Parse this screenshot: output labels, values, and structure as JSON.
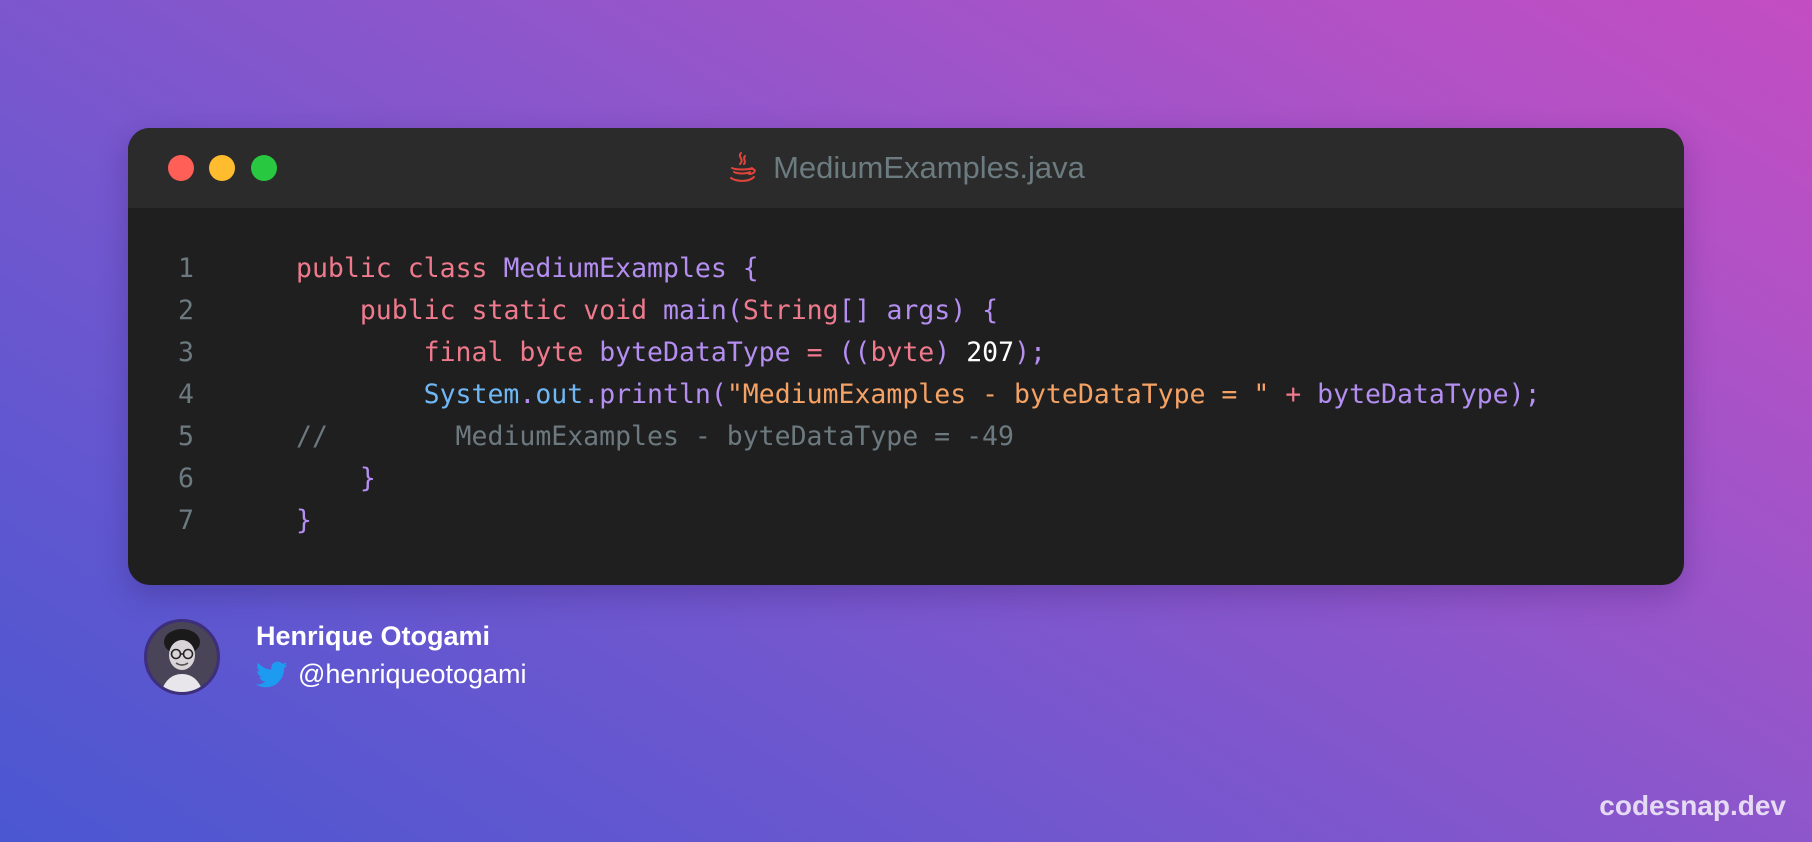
{
  "window": {
    "filename": "MediumExamples.java",
    "language_icon": "java-icon",
    "controls": [
      "close",
      "minimize",
      "maximize"
    ]
  },
  "code": {
    "lines": [
      {
        "number": "1",
        "tokens": [
          {
            "t": "public",
            "c": "kw"
          },
          {
            "t": " ",
            "c": ""
          },
          {
            "t": "class",
            "c": "kw"
          },
          {
            "t": " ",
            "c": ""
          },
          {
            "t": "MediumExamples",
            "c": "cls"
          },
          {
            "t": " {",
            "c": "punc"
          }
        ]
      },
      {
        "number": "2",
        "tokens": [
          {
            "t": "    ",
            "c": ""
          },
          {
            "t": "public",
            "c": "kw"
          },
          {
            "t": " ",
            "c": ""
          },
          {
            "t": "static",
            "c": "kw"
          },
          {
            "t": " ",
            "c": ""
          },
          {
            "t": "void",
            "c": "kw"
          },
          {
            "t": " ",
            "c": ""
          },
          {
            "t": "main",
            "c": "cls"
          },
          {
            "t": "(",
            "c": "punc"
          },
          {
            "t": "String",
            "c": "kw"
          },
          {
            "t": "[] ",
            "c": "punc"
          },
          {
            "t": "args",
            "c": "cls"
          },
          {
            "t": ") {",
            "c": "punc"
          }
        ]
      },
      {
        "number": "3",
        "tokens": [
          {
            "t": "        ",
            "c": ""
          },
          {
            "t": "final",
            "c": "kw"
          },
          {
            "t": " ",
            "c": ""
          },
          {
            "t": "byte",
            "c": "kw"
          },
          {
            "t": " ",
            "c": ""
          },
          {
            "t": "byteDataType",
            "c": "cls"
          },
          {
            "t": " = ",
            "c": "op"
          },
          {
            "t": "((",
            "c": "punc"
          },
          {
            "t": "byte",
            "c": "kw"
          },
          {
            "t": ") ",
            "c": "punc"
          },
          {
            "t": "207",
            "c": "num"
          },
          {
            "t": ");",
            "c": "punc"
          }
        ]
      },
      {
        "number": "4",
        "tokens": [
          {
            "t": "        ",
            "c": ""
          },
          {
            "t": "System",
            "c": "sys"
          },
          {
            "t": ".",
            "c": "punc"
          },
          {
            "t": "out",
            "c": "sys"
          },
          {
            "t": ".",
            "c": "punc"
          },
          {
            "t": "println",
            "c": "cls"
          },
          {
            "t": "(",
            "c": "punc"
          },
          {
            "t": "\"MediumExamples - byteDataType = \"",
            "c": "str"
          },
          {
            "t": " + ",
            "c": "op"
          },
          {
            "t": "byteDataType",
            "c": "cls"
          },
          {
            "t": ");",
            "c": "punc"
          }
        ]
      },
      {
        "number": "5",
        "tokens": [
          {
            "t": "//        MediumExamples - byteDataType = -49",
            "c": "cmt"
          }
        ]
      },
      {
        "number": "6",
        "tokens": [
          {
            "t": "    ",
            "c": ""
          },
          {
            "t": "}",
            "c": "punc"
          }
        ]
      },
      {
        "number": "7",
        "tokens": [
          {
            "t": "}",
            "c": "punc"
          }
        ]
      }
    ]
  },
  "author": {
    "name": "Henrique Otogami",
    "handle": "@henriqueotogami",
    "avatar_icon": "avatar",
    "social_icon": "twitter-icon"
  },
  "brand": "codesnap.dev",
  "colors": {
    "keyword": "#f07a8d",
    "identifier": "#b48ef0",
    "system": "#6fb7f5",
    "string": "#f5a264",
    "number": "#ffffff",
    "comment": "#6c7a80",
    "window_bg": "#1f1f1f",
    "titlebar_bg": "#2b2b2b"
  }
}
